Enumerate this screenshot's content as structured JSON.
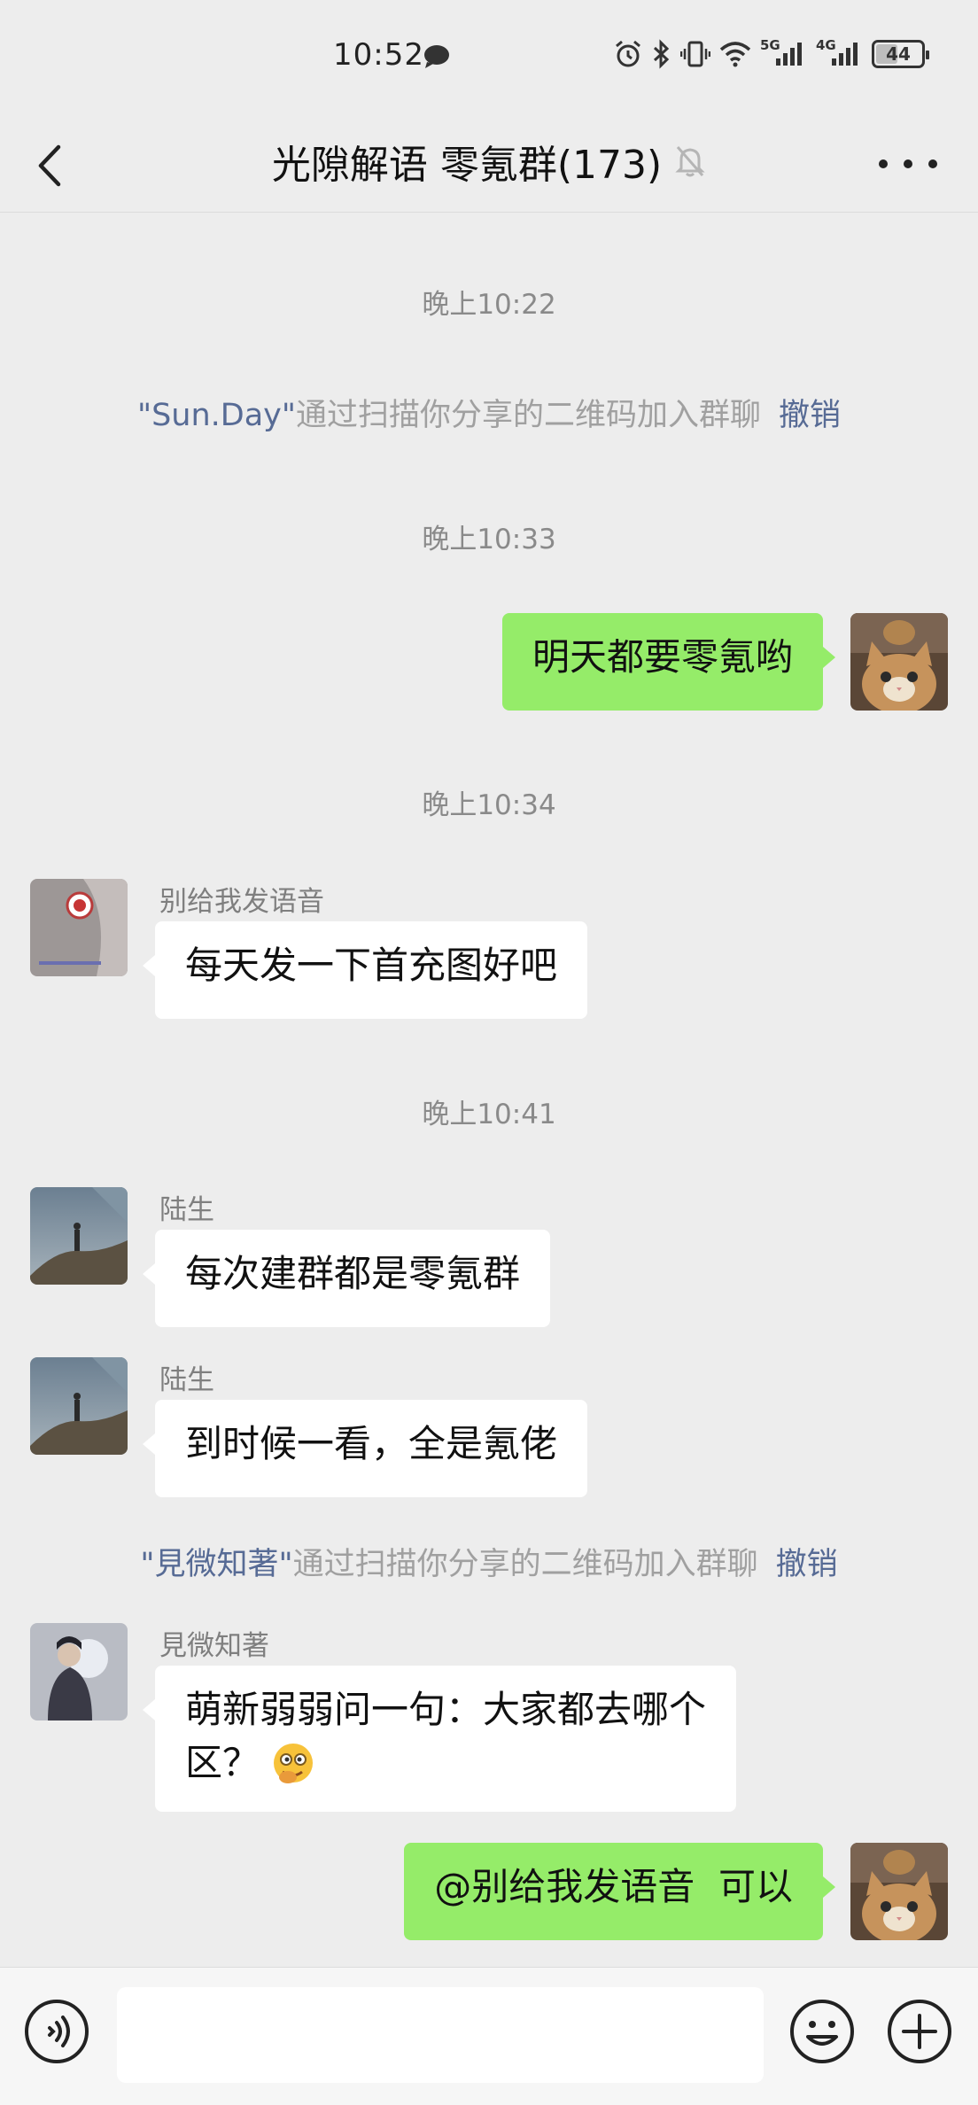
{
  "status_bar": {
    "time": "10:52",
    "signal_1": "5G",
    "signal_2": "4G",
    "battery": "44",
    "battery_level_percent": 44
  },
  "header": {
    "title": "光隙解语 零氪群(173)"
  },
  "messages": {
    "time_1": "晚上10:22",
    "sys_1": {
      "q_open": "\"",
      "name": "Sun.Day",
      "q_close": "\"",
      "text": "通过扫描你分享的二维码加入群聊",
      "undo": "撤销"
    },
    "time_2": "晚上10:33",
    "self_1": "明天都要零氪哟",
    "time_3": "晚上10:34",
    "msg_1": {
      "sender": "别给我发语音",
      "text": "每天发一下首充图好吧"
    },
    "time_4": "晚上10:41",
    "msg_2": {
      "sender": "陆生",
      "text": "每次建群都是零氪群"
    },
    "msg_3": {
      "sender": "陆生",
      "text": "到时候一看，全是氪佬"
    },
    "sys_2": {
      "q_open": "\"",
      "name": "見微知著",
      "q_close": "\"",
      "text": "通过扫描你分享的二维码加入群聊",
      "undo": "撤销"
    },
    "msg_4": {
      "sender": "見微知著",
      "text_line1": "萌新弱弱问一句：大家都去哪个",
      "text_line2": "区？"
    },
    "self_2": "@别给我发语音  可以"
  },
  "colors": {
    "background": "#ededed",
    "self_bubble": "#95ec69",
    "link": "#576b95"
  },
  "icons": [
    "back-arrow-icon",
    "mute-bell-icon",
    "more-icon",
    "voice-icon",
    "emoji-icon",
    "plus-icon"
  ]
}
